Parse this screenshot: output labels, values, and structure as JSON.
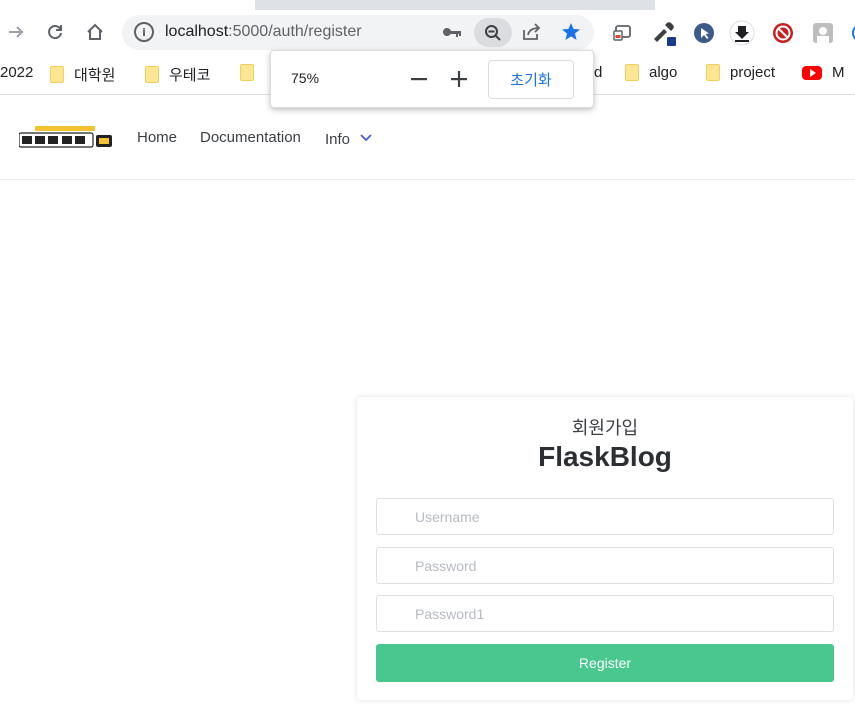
{
  "browser": {
    "url_host": "localhost",
    "url_rest": ":5000/auth/register",
    "bookmarks": [
      {
        "label": "2022",
        "icon": "folder-icon"
      },
      {
        "label": "대학원",
        "icon": "folder-icon"
      },
      {
        "label": "우테코",
        "icon": "folder-icon"
      },
      {
        "label": "d",
        "icon": "folder-icon"
      },
      {
        "label": "algo",
        "icon": "folder-icon"
      },
      {
        "label": "project",
        "icon": "folder-icon"
      },
      {
        "label": "M",
        "icon": "youtube-icon"
      }
    ],
    "zoom_popup": {
      "percent": "75%",
      "reset_label": "초기화"
    }
  },
  "navbar": {
    "links": [
      "Home",
      "Documentation",
      "Info"
    ]
  },
  "register": {
    "subtitle": "회원가입",
    "title": "FlaskBlog",
    "username_placeholder": "Username",
    "password_placeholder": "Password",
    "password1_placeholder": "Password1",
    "submit_label": "Register"
  },
  "colors": {
    "accent_green": "#48c78e",
    "reset_blue": "#1a73e8",
    "star_blue": "#1a73e8",
    "logo_gold": "#f2c230"
  }
}
